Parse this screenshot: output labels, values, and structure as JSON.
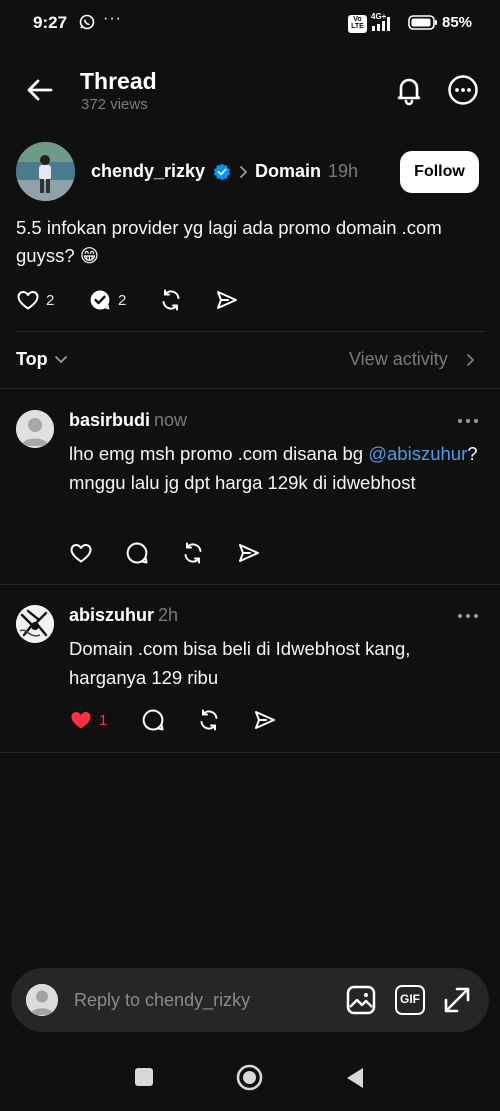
{
  "status_bar": {
    "time": "9:27",
    "dots": "···",
    "volte": "Vo LTE",
    "network": "4G+",
    "battery": "85%"
  },
  "header": {
    "title": "Thread",
    "views": "372 views"
  },
  "post": {
    "username": "chendy_rizky",
    "topic": "Domain",
    "time": "19h",
    "follow_label": "Follow",
    "text": "5.5 infokan provider yg lagi ada promo domain .com guyss? 😁",
    "likes": "2",
    "replies": "2"
  },
  "sort": {
    "label": "Top",
    "view_activity": "View activity"
  },
  "replies": [
    {
      "username": "basirbudi",
      "time": "now",
      "text_before": "lho emg msh promo .com disana bg ",
      "mention": "@abiszuhur",
      "text_after": "? mnggu lalu jg dpt harga 129k di idwebhost",
      "likes": ""
    },
    {
      "username": "abiszuhur",
      "time": "2h",
      "text": "Domain .com bisa beli di Idwebhost kang, harganya 129 ribu",
      "likes": "1"
    }
  ],
  "composer": {
    "placeholder": "Reply to chendy_rizky",
    "gif_label": "GIF"
  },
  "colors": {
    "background": "#101010",
    "mention": "#4f9be8",
    "liked": "#ff3040",
    "verified": "#0095f6"
  }
}
